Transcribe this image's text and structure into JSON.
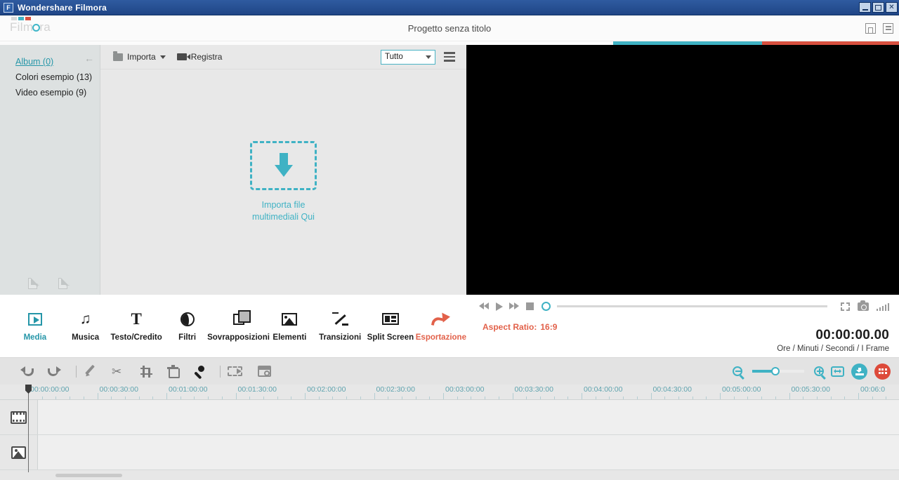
{
  "window": {
    "title": "Wondershare Filmora",
    "app_icon": "filmora-f-icon",
    "minimize": "minimize-icon",
    "maximize": "maximize-icon",
    "close": "close-icon"
  },
  "header": {
    "brand": "Filmora",
    "brand_prefix": "Film",
    "brand_suffix": "ra",
    "project_title": "Progetto senza titolo",
    "save_icon": "save-icon",
    "menu_icon": "menu-icon",
    "accent_teal": "#3fb2c4",
    "accent_red": "#d8503f"
  },
  "library_sidebar": {
    "collapse_icon": "collapse-left-arrow-icon",
    "items": [
      {
        "label": "Album (0)",
        "active": true
      },
      {
        "label": "Colori esempio (13)",
        "active": false
      },
      {
        "label": "Video esempio (9)",
        "active": false
      }
    ],
    "add_folder_icon": "add-folder-icon",
    "remove_folder_icon": "remove-folder-icon"
  },
  "library_toolbar": {
    "import_label": "Importa",
    "import_icon": "folder-icon",
    "record_label": "Registra",
    "record_icon": "camera-icon",
    "filter_value": "Tutto",
    "filter_options": [
      "Tutto"
    ],
    "list_view_icon": "hamburger-icon"
  },
  "drop_zone": {
    "icon": "download-arrow-icon",
    "line1": "Importa file",
    "line2": "multimediali Qui"
  },
  "categories": [
    {
      "label": "Media",
      "icon": "media-icon",
      "state": "active"
    },
    {
      "label": "Musica",
      "icon": "music-note-icon",
      "state": "normal"
    },
    {
      "label": "Testo/Credito",
      "icon": "text-t-icon",
      "state": "normal"
    },
    {
      "label": "Filtri",
      "icon": "filter-circle-icon",
      "state": "normal"
    },
    {
      "label": "Sovrapposizioni",
      "icon": "overlay-squares-icon",
      "state": "normal"
    },
    {
      "label": "Elementi",
      "icon": "image-icon",
      "state": "normal"
    },
    {
      "label": "Transizioni",
      "icon": "transition-arrows-icon",
      "state": "normal"
    },
    {
      "label": "Split Screen",
      "icon": "split-screen-icon",
      "state": "normal"
    },
    {
      "label": "Esportazione",
      "icon": "export-arrow-icon",
      "state": "export"
    }
  ],
  "player": {
    "prev_icon": "rewind-icon",
    "play_icon": "play-icon",
    "next_icon": "fast-forward-icon",
    "stop_icon": "stop-icon",
    "scrub_position_percent": 0,
    "fullscreen_icon": "fullscreen-icon",
    "snapshot_icon": "snapshot-camera-icon",
    "volume_icon": "volume-bars-icon",
    "aspect_label": "Aspect Ratio:",
    "aspect_value": "16:9",
    "timecode": "00:00:00.00",
    "timecode_legend": "Ore / Minuti / Secondi / I Frame"
  },
  "timeline_toolbar": {
    "buttons": [
      {
        "icon": "undo-icon"
      },
      {
        "icon": "redo-icon"
      },
      {
        "icon": "separator"
      },
      {
        "icon": "edit-pencil-icon"
      },
      {
        "icon": "split-scissors-icon"
      },
      {
        "icon": "crop-icon"
      },
      {
        "icon": "delete-trash-icon"
      },
      {
        "icon": "voiceover-mic-icon"
      },
      {
        "icon": "separator"
      },
      {
        "icon": "speed-render-icon"
      },
      {
        "icon": "project-settings-icon"
      }
    ],
    "zoom_out_icon": "zoom-out-icon",
    "zoom_in_icon": "zoom-in-icon",
    "zoom_level_percent": 45,
    "fit_icon": "fit-to-timeline-icon",
    "save_button_icon": "save-circle-icon",
    "grid_button_icon": "grid-circle-icon"
  },
  "timeline": {
    "ruler_labels": [
      "00:00:00:00",
      "00:00:30:00",
      "00:01:00:00",
      "00:01:30:00",
      "00:02:00:00",
      "00:02:30:00",
      "00:03:00:00",
      "00:03:30:00",
      "00:04:00:00",
      "00:04:30:00",
      "00:05:00:00",
      "00:05:30:00",
      "00:06:0"
    ],
    "playhead_label": "00:00:00:00",
    "tracks": [
      {
        "icon": "video-track-icon",
        "name": "video-track"
      },
      {
        "icon": "image-track-icon",
        "name": "image-track"
      }
    ]
  }
}
